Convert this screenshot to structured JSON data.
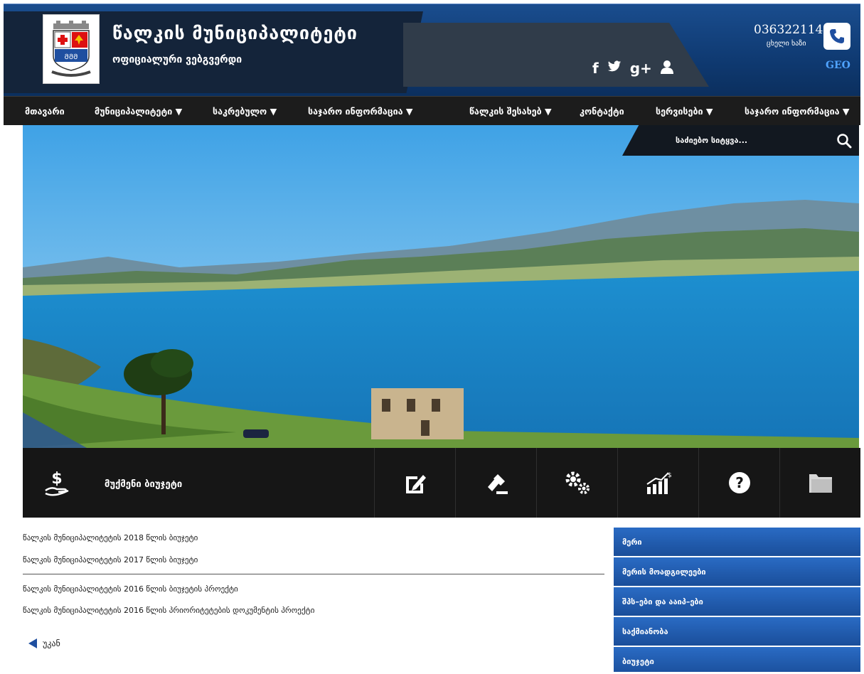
{
  "header": {
    "title": "წალკის მუნიციპალიტეტი",
    "subtitle": "ოფიციალური ვებგვერდი",
    "phone": "0363221141",
    "phone_label": "ცხელი ხაზი",
    "language": "GEO",
    "social": [
      "f",
      "t",
      "g+",
      "user"
    ]
  },
  "nav": {
    "items": [
      {
        "label": "მთავარი"
      },
      {
        "label": "მუნიციპალიტეტი ▼"
      },
      {
        "label": "საკრებულო ▼"
      },
      {
        "label": "საჯარო ინფორმაცია ▼"
      },
      {
        "label": "წალკის შესახებ ▼"
      },
      {
        "label": "კონტაქტი"
      },
      {
        "label": "სერვისები ▼"
      },
      {
        "label": "საჯარო ინფორმაცია ▼"
      }
    ]
  },
  "search": {
    "placeholder": "საძიებო სიტყვა..."
  },
  "iconbar": {
    "first_label": "მუქმენი ბიუჯეტი",
    "icons": [
      "money-hand-icon",
      "edit-icon",
      "gavel-icon",
      "gears-icon",
      "chart-icon",
      "question-icon",
      "folder-icon"
    ]
  },
  "documents": [
    "წალკის მუნიციპალიტეტის 2018 წლის ბიუჯეტი",
    "წალკის მუნიციპალიტეტის 2017 წლის ბიუჯეტი",
    "წალკის მუნიციპალიტეტის 2016 წლის ბიუჯეტის პროექტი",
    "წალკის მუნიციპალიტეტის 2016 წლის პრიორიტეტების დოკუმენტის პროექტი"
  ],
  "back_label": "უკან",
  "sidebar": {
    "items": [
      "მერი",
      "მერის მოადგილეები",
      "შპს–ები და ააიპ–ები",
      "საქმიანობა",
      "ბიუჯეტი"
    ]
  },
  "colors": {
    "header_blue": "#1a4d8e",
    "nav_bg": "#1c1c1c",
    "sidebar_blue": "#2a6bc4",
    "lang_link": "#4fa3ff"
  }
}
